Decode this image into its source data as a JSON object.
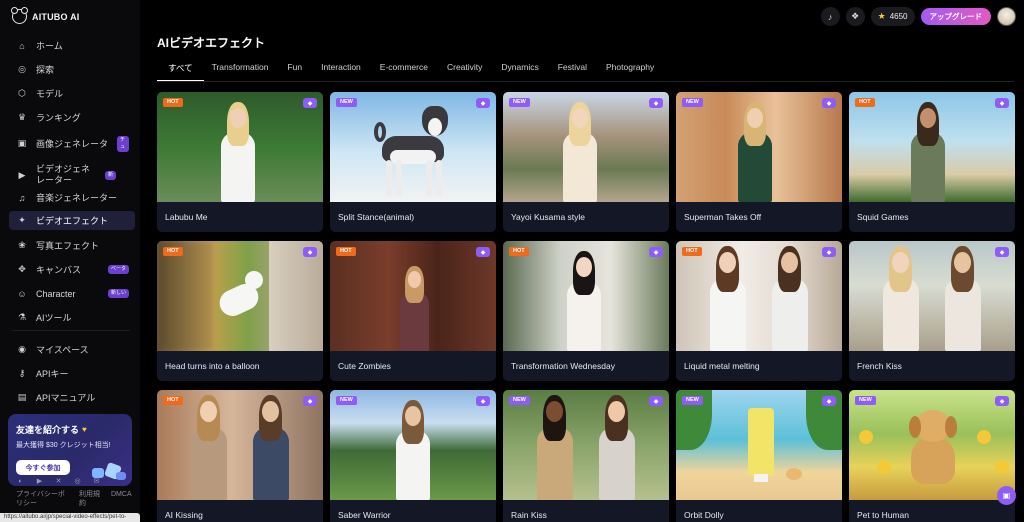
{
  "brand": {
    "name": "AITUBO AI"
  },
  "sidebar": {
    "items": [
      {
        "label": "ホーム",
        "icon": "home-icon",
        "glyph": "⌂"
      },
      {
        "label": "探索",
        "icon": "compass-icon",
        "glyph": "◎"
      },
      {
        "label": "モデル",
        "icon": "cube-icon",
        "glyph": "⬡"
      },
      {
        "label": "ランキング",
        "icon": "trophy-icon",
        "glyph": "♛"
      },
      {
        "label": "画像ジェネレータ",
        "icon": "image-icon",
        "glyph": "▣",
        "badge": "チュ"
      },
      {
        "label": "ビデオジェネレーター",
        "icon": "video-icon",
        "glyph": "▶",
        "badge": "新"
      },
      {
        "label": "音楽ジェネレーター",
        "icon": "music-icon",
        "glyph": "♫"
      },
      {
        "label": "ビデオエフェクト",
        "icon": "video-effect-icon",
        "glyph": "✦"
      },
      {
        "label": "写真エフェクト",
        "icon": "photo-effect-icon",
        "glyph": "❀"
      },
      {
        "label": "キャンバス",
        "icon": "canvas-icon",
        "glyph": "✥",
        "badge": "ベータ"
      },
      {
        "label": "Character",
        "icon": "character-icon",
        "glyph": "☺",
        "badge": "新しい"
      },
      {
        "label": "AIツール",
        "icon": "flask-icon",
        "glyph": "⚗"
      },
      {
        "label": "マイスペース",
        "icon": "space-icon",
        "glyph": "◉"
      },
      {
        "label": "APIキー",
        "icon": "key-icon",
        "glyph": "⚷"
      },
      {
        "label": "APIマニュアル",
        "icon": "doc-icon",
        "glyph": "▤"
      }
    ],
    "invite": {
      "title": "友達を紹介する",
      "subtitle": "最大獲得 $30 クレジット相当!",
      "button": "今すぐ参加"
    },
    "footer": {
      "privacy": "プライバシーポリシー",
      "terms": "利用規約",
      "dmca": "DMCA"
    },
    "status_url": "https://aitubo.ai/jp/special-video-effects/pet-to-human/"
  },
  "topbar": {
    "credits": "4650",
    "upgrade": "アップグレード"
  },
  "main": {
    "title": "AIビデオエフェクト",
    "tabs": [
      "すべて",
      "Transformation",
      "Fun",
      "Interaction",
      "E-commerce",
      "Creativity",
      "Dynamics",
      "Festival",
      "Photography"
    ]
  },
  "cards": [
    {
      "title": "Labubu Me",
      "tag": "HOT"
    },
    {
      "title": "Split Stance(animal)",
      "tag": "NEW"
    },
    {
      "title": "Yayoi Kusama style",
      "tag": "NEW"
    },
    {
      "title": "Superman Takes Off",
      "tag": "NEW"
    },
    {
      "title": "Squid Games",
      "tag": "HOT"
    },
    {
      "title": "Head turns into a balloon",
      "tag": "HOT"
    },
    {
      "title": "Cute Zombies",
      "tag": "HOT"
    },
    {
      "title": "Transformation Wednesday",
      "tag": "HOT"
    },
    {
      "title": "Liquid metal melting",
      "tag": "HOT"
    },
    {
      "title": "French Kiss",
      "tag": ""
    },
    {
      "title": "AI Kissing",
      "tag": "HOT"
    },
    {
      "title": "Saber Warrior",
      "tag": "NEW"
    },
    {
      "title": "Rain Kiss",
      "tag": "NEW"
    },
    {
      "title": "Orbit Dolly",
      "tag": "NEW"
    },
    {
      "title": "Pet to Human",
      "tag": "NEW"
    }
  ]
}
